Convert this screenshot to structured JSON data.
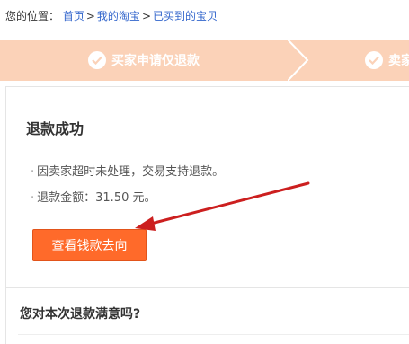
{
  "breadcrumb": {
    "prefix": "您的位置：",
    "items": [
      "首页",
      "我的淘宝",
      "已买到的宝贝"
    ],
    "separator": ">"
  },
  "steps": [
    {
      "label": "买家申请仅退款",
      "icon": "check-icon"
    },
    {
      "label": "卖家",
      "icon": "check-icon"
    }
  ],
  "main": {
    "title": "退款成功",
    "info": [
      "因卖家超时未处理，交易支持退款。",
      "退款金额：31.50 元。"
    ],
    "button_label": "查看钱款去向",
    "bullet": "·"
  },
  "feedback": {
    "question": "您对本次退款满意吗?"
  },
  "colors": {
    "step_bar": "#fbd2b8",
    "button": "#ff6a2a",
    "link": "#3366cc",
    "annotation_arrow": "#cc1f1f"
  }
}
